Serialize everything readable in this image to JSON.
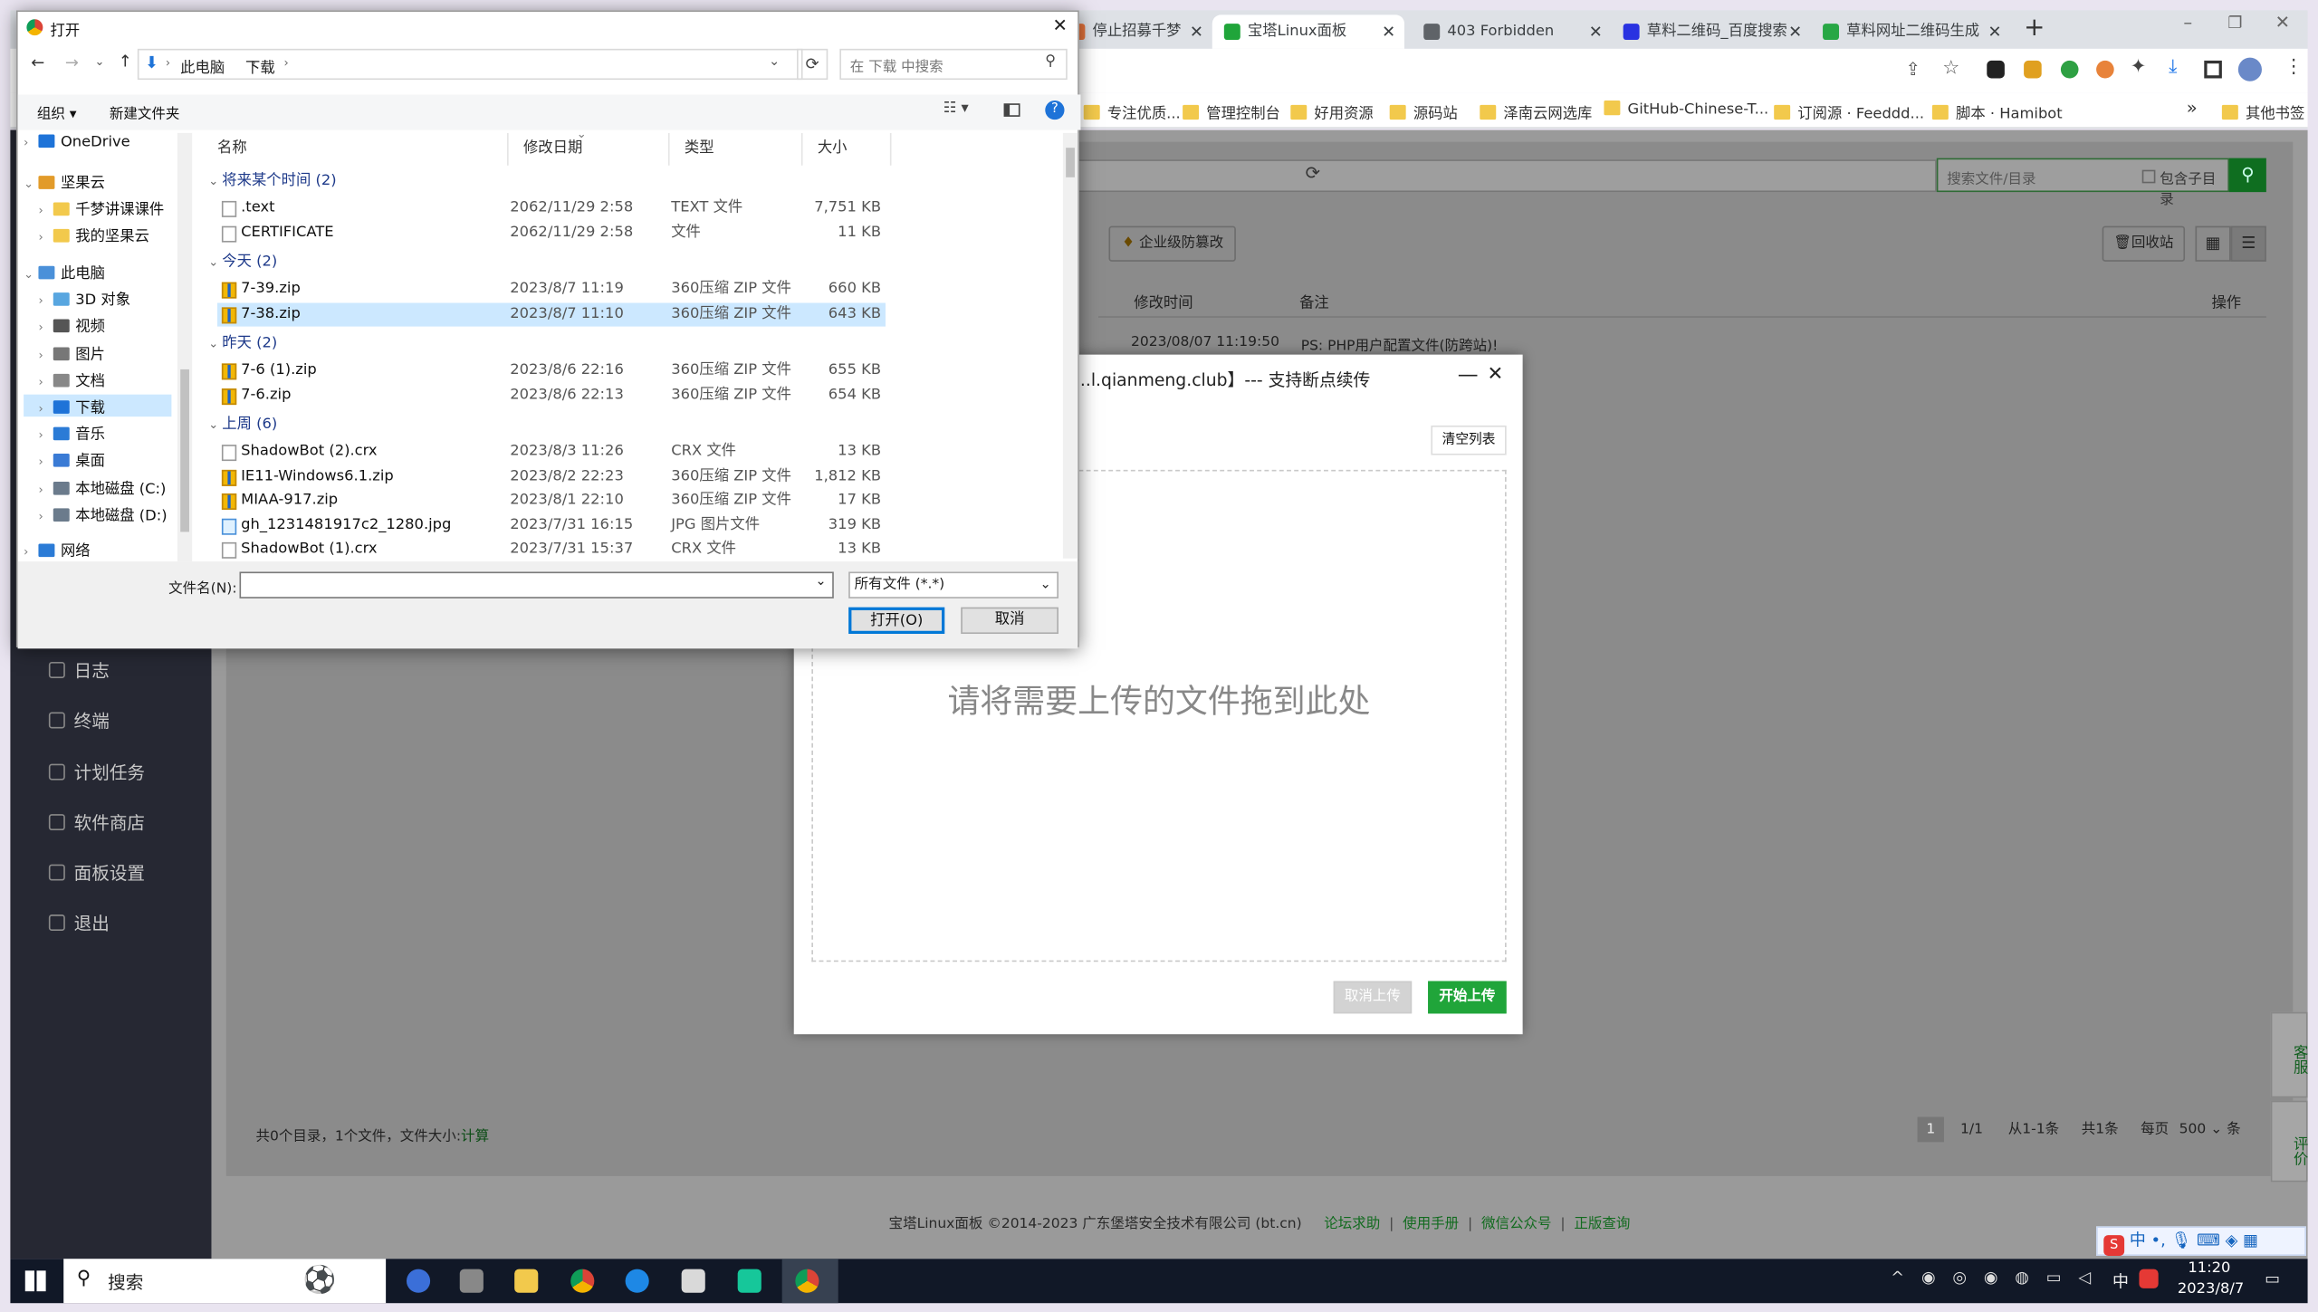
{
  "browser": {
    "tabs": [
      {
        "label": "停止招募千梦",
        "favicon_color": "#e5733b",
        "active": false
      },
      {
        "label": "宝塔Linux面板",
        "favicon_color": "#20a53a",
        "active": true
      },
      {
        "label": "403 Forbidden",
        "favicon_color": "#5f6368",
        "active": false
      },
      {
        "label": "草料二维码_百度搜索",
        "favicon_color": "#2932e1",
        "active": false
      },
      {
        "label": "草料网址二维码生成",
        "favicon_color": "#28a745",
        "active": false
      }
    ],
    "new_tab": "+",
    "bookmarks": [
      "专注优质...",
      "管理控制台",
      "好用资源",
      "源码站",
      "泽南云网选库",
      "GitHub-Chinese-T...",
      "订阅源 · Feeddd...",
      "脚本 · Hamibot",
      "其他书签"
    ],
    "more": "»"
  },
  "panel": {
    "search_placeholder": "搜索文件/目录",
    "include_subdir": "包含子目录",
    "enterprise_btn": "企业级防篡改",
    "recycle_btn": "回收站",
    "col_mtime": "修改时间",
    "col_remark": "备注",
    "col_ops": "操作",
    "row_mtime": "2023/08/07 11:19:50",
    "row_remark": "PS: PHP用户配置文件(防跨站)!",
    "menu": [
      "日志",
      "终端",
      "计划任务",
      "软件商店",
      "面板设置",
      "退出"
    ],
    "summary": "共0个目录，1个文件，文件大小:",
    "summary_link": "计算",
    "pager": {
      "page": "1",
      "of": "1/1",
      "range": "从1-1条",
      "total": "共1条",
      "per_label": "每页",
      "per": "500",
      "unit": "条"
    },
    "footer": "宝塔Linux面板 ©2014-2023 广东堡塔安全技术有限公司 (bt.cn)",
    "footer_links": [
      "论坛求助",
      "使用手册",
      "微信公众号",
      "正版查询"
    ],
    "side_tools": [
      "客服",
      "评价"
    ]
  },
  "upload": {
    "title": "...l.qianmeng.club】--- 支持断点续传",
    "clear": "清空列表",
    "drop_hint": "请将需要上传的文件拖到此处",
    "cancel": "取消上传",
    "start": "开始上传"
  },
  "dialog": {
    "title": "打开",
    "path": [
      "此电脑",
      "下载"
    ],
    "search_placeholder": "在 下载 中搜索",
    "organize": "组织 ▾",
    "new_folder": "新建文件夹",
    "tree": [
      {
        "label": "OneDrive",
        "color": "#1e73d8",
        "indent": 1,
        "sel": false
      },
      {
        "label": "坚果云",
        "color": "#e29b2a",
        "indent": 0,
        "sel": false
      },
      {
        "label": "千梦讲课课件",
        "color": "#f2c94c",
        "indent": 2,
        "sel": false
      },
      {
        "label": "我的坚果云",
        "color": "#f2c94c",
        "indent": 2,
        "sel": false
      },
      {
        "label": "此电脑",
        "color": "#4a90d9",
        "indent": 0,
        "sel": false
      },
      {
        "label": "3D 对象",
        "color": "#58a6e0",
        "indent": 2,
        "sel": false
      },
      {
        "label": "视频",
        "color": "#555555",
        "indent": 2,
        "sel": false
      },
      {
        "label": "图片",
        "color": "#777777",
        "indent": 2,
        "sel": false
      },
      {
        "label": "文档",
        "color": "#888888",
        "indent": 2,
        "sel": false
      },
      {
        "label": "下载",
        "color": "#1e73d8",
        "indent": 2,
        "sel": true
      },
      {
        "label": "音乐",
        "color": "#2b7bd6",
        "indent": 2,
        "sel": false
      },
      {
        "label": "桌面",
        "color": "#3a7bd5",
        "indent": 2,
        "sel": false
      },
      {
        "label": "本地磁盘 (C:)",
        "color": "#6b7b8c",
        "indent": 2,
        "sel": false
      },
      {
        "label": "本地磁盘 (D:)",
        "color": "#6b7b8c",
        "indent": 2,
        "sel": false
      },
      {
        "label": "网络",
        "color": "#2b7bd6",
        "indent": 0,
        "sel": false
      }
    ],
    "columns": [
      "名称",
      "修改日期",
      "类型",
      "大小"
    ],
    "groups": [
      {
        "label": "将来某个时间 (2)",
        "files": [
          {
            "name": ".text",
            "date": "2062/11/29 2:58",
            "type": "TEXT 文件",
            "size": "7,751 KB",
            "kind": "doc"
          },
          {
            "name": "CERTIFICATE",
            "date": "2062/11/29 2:58",
            "type": "文件",
            "size": "11 KB",
            "kind": "doc"
          }
        ]
      },
      {
        "label": "今天 (2)",
        "files": [
          {
            "name": "7-39.zip",
            "date": "2023/8/7 11:19",
            "type": "360压缩 ZIP 文件",
            "size": "660 KB",
            "kind": "zip"
          },
          {
            "name": "7-38.zip",
            "date": "2023/8/7 11:10",
            "type": "360压缩 ZIP 文件",
            "size": "643 KB",
            "kind": "zip",
            "sel": true
          }
        ]
      },
      {
        "label": "昨天 (2)",
        "files": [
          {
            "name": "7-6 (1).zip",
            "date": "2023/8/6 22:16",
            "type": "360压缩 ZIP 文件",
            "size": "655 KB",
            "kind": "zip"
          },
          {
            "name": "7-6.zip",
            "date": "2023/8/6 22:13",
            "type": "360压缩 ZIP 文件",
            "size": "654 KB",
            "kind": "zip"
          }
        ]
      },
      {
        "label": "上周 (6)",
        "files": [
          {
            "name": "ShadowBot (2).crx",
            "date": "2023/8/3 11:26",
            "type": "CRX 文件",
            "size": "13 KB",
            "kind": "doc"
          },
          {
            "name": "IE11-Windows6.1.zip",
            "date": "2023/8/2 22:23",
            "type": "360压缩 ZIP 文件",
            "size": "1,812 KB",
            "kind": "zip"
          },
          {
            "name": "MIAA-917.zip",
            "date": "2023/8/1 22:10",
            "type": "360压缩 ZIP 文件",
            "size": "17 KB",
            "kind": "zip"
          },
          {
            "name": "gh_1231481917c2_1280.jpg",
            "date": "2023/7/31 16:15",
            "type": "JPG 图片文件",
            "size": "319 KB",
            "kind": "jpg"
          },
          {
            "name": "ShadowBot (1).crx",
            "date": "2023/7/31 15:37",
            "type": "CRX 文件",
            "size": "13 KB",
            "kind": "doc"
          }
        ]
      }
    ],
    "filename_label": "文件名(N):",
    "filename_value": "",
    "filetype": "所有文件 (*.*)",
    "open": "打开(O)",
    "cancel": "取消"
  },
  "taskbar": {
    "search": "搜索",
    "time": "11:20",
    "date": "2023/8/7",
    "ime": "中"
  }
}
